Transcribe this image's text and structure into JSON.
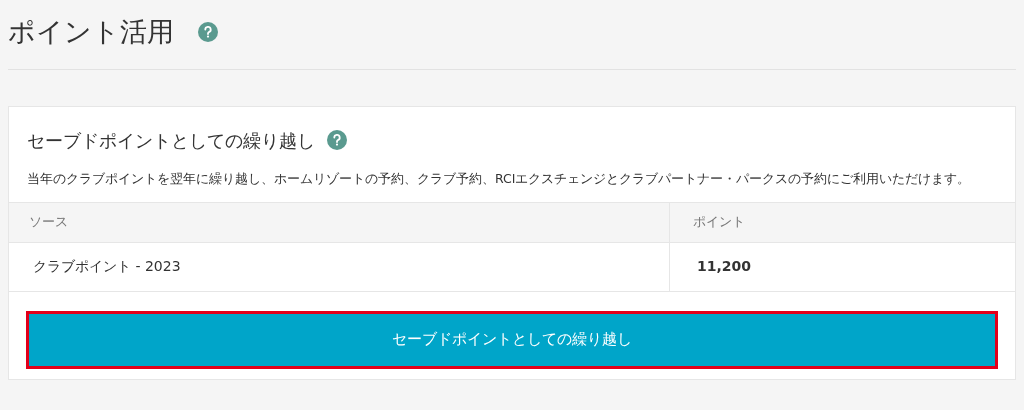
{
  "page_title": "ポイント活用",
  "card": {
    "title": "セーブドポイントとしての繰り越し",
    "description": "当年のクラブポイントを翌年に繰り越し、ホームリゾートの予約、クラブ予約、RCIエクスチェンジとクラブパートナー・パークスの予約にご利用いただけます。",
    "table": {
      "columns": [
        "ソース",
        "ポイント"
      ],
      "rows": [
        {
          "source": "クラブポイント - 2023",
          "points": "11,200"
        }
      ]
    },
    "button": {
      "label": "セーブドポイントとしての繰り越し",
      "highlighted": true
    }
  }
}
